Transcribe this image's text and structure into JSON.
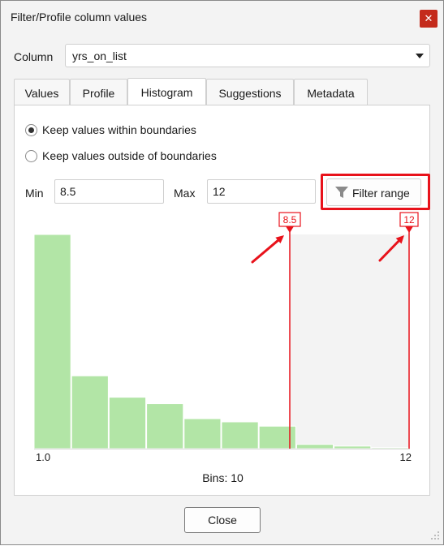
{
  "window": {
    "title": "Filter/Profile column values",
    "close_icon": "close-icon"
  },
  "column": {
    "label": "Column",
    "value": "yrs_on_list"
  },
  "tabs": [
    {
      "label": "Values"
    },
    {
      "label": "Profile"
    },
    {
      "label": "Histogram",
      "active": true
    },
    {
      "label": "Suggestions"
    },
    {
      "label": "Metadata"
    }
  ],
  "options": {
    "within": {
      "label": "Keep values within boundaries",
      "checked": true
    },
    "outside": {
      "label": "Keep values outside of boundaries",
      "checked": false
    }
  },
  "range": {
    "min_label": "Min",
    "min_value": "8.5",
    "max_label": "Max",
    "max_value": "12",
    "filter_button": "Filter range",
    "filter_icon": "funnel-icon"
  },
  "chart_data": {
    "type": "bar",
    "x_min": 1.0,
    "x_max": 12,
    "x_min_label": "1.0",
    "x_max_label": "12",
    "bins_label": "Bins: 10",
    "values": [
      100,
      34,
      24,
      21,
      14,
      12.5,
      10.5,
      2,
      1.2,
      0.5
    ],
    "boundary_min": {
      "value": 8.5,
      "label": "8.5"
    },
    "boundary_max": {
      "value": 12,
      "label": "12"
    },
    "bar_color": "#b2e5a6",
    "marker_color": "#e8121b",
    "excluded_shade": "#f3f3f3"
  },
  "footer": {
    "close_button": "Close"
  },
  "colors": {
    "accent_red": "#e8121b",
    "close_red": "#c42b1c"
  }
}
